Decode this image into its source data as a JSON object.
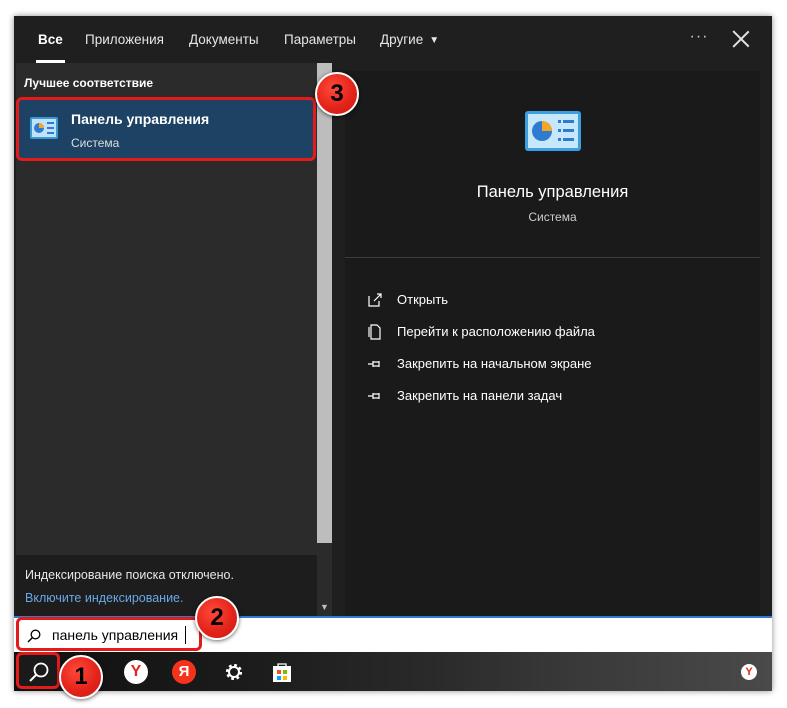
{
  "tabs": [
    {
      "label": "Все",
      "active": true
    },
    {
      "label": "Приложения"
    },
    {
      "label": "Документы"
    },
    {
      "label": "Параметры"
    },
    {
      "label": "Другие"
    }
  ],
  "window": {
    "more_label": "···"
  },
  "best_match": {
    "section_title": "Лучшее соответствие",
    "title": "Панель управления",
    "subtitle": "Система"
  },
  "indexing": {
    "notice": "Индексирование поиска отключено.",
    "link": "Включите индексирование."
  },
  "details": {
    "title": "Панель управления",
    "subtitle": "Система",
    "actions": [
      {
        "label": "Открыть",
        "icon": "open-icon"
      },
      {
        "label": "Перейти к расположению файла",
        "icon": "file-location-icon"
      },
      {
        "label": "Закрепить на начальном экране",
        "icon": "pin-icon"
      },
      {
        "label": "Закрепить на панели задач",
        "icon": "pin-icon"
      }
    ]
  },
  "search": {
    "value": "панель управления"
  },
  "taskbar": {
    "yabro_glyph": "Y",
    "yandex_glyph": "Я",
    "tray_glyph": "Y"
  },
  "badges": [
    "1",
    "2",
    "3"
  ],
  "colors": {
    "highlight": "#e21b1b",
    "accent": "#2f7bd2",
    "selected": "#1e4263",
    "link": "#6aa7e6"
  }
}
